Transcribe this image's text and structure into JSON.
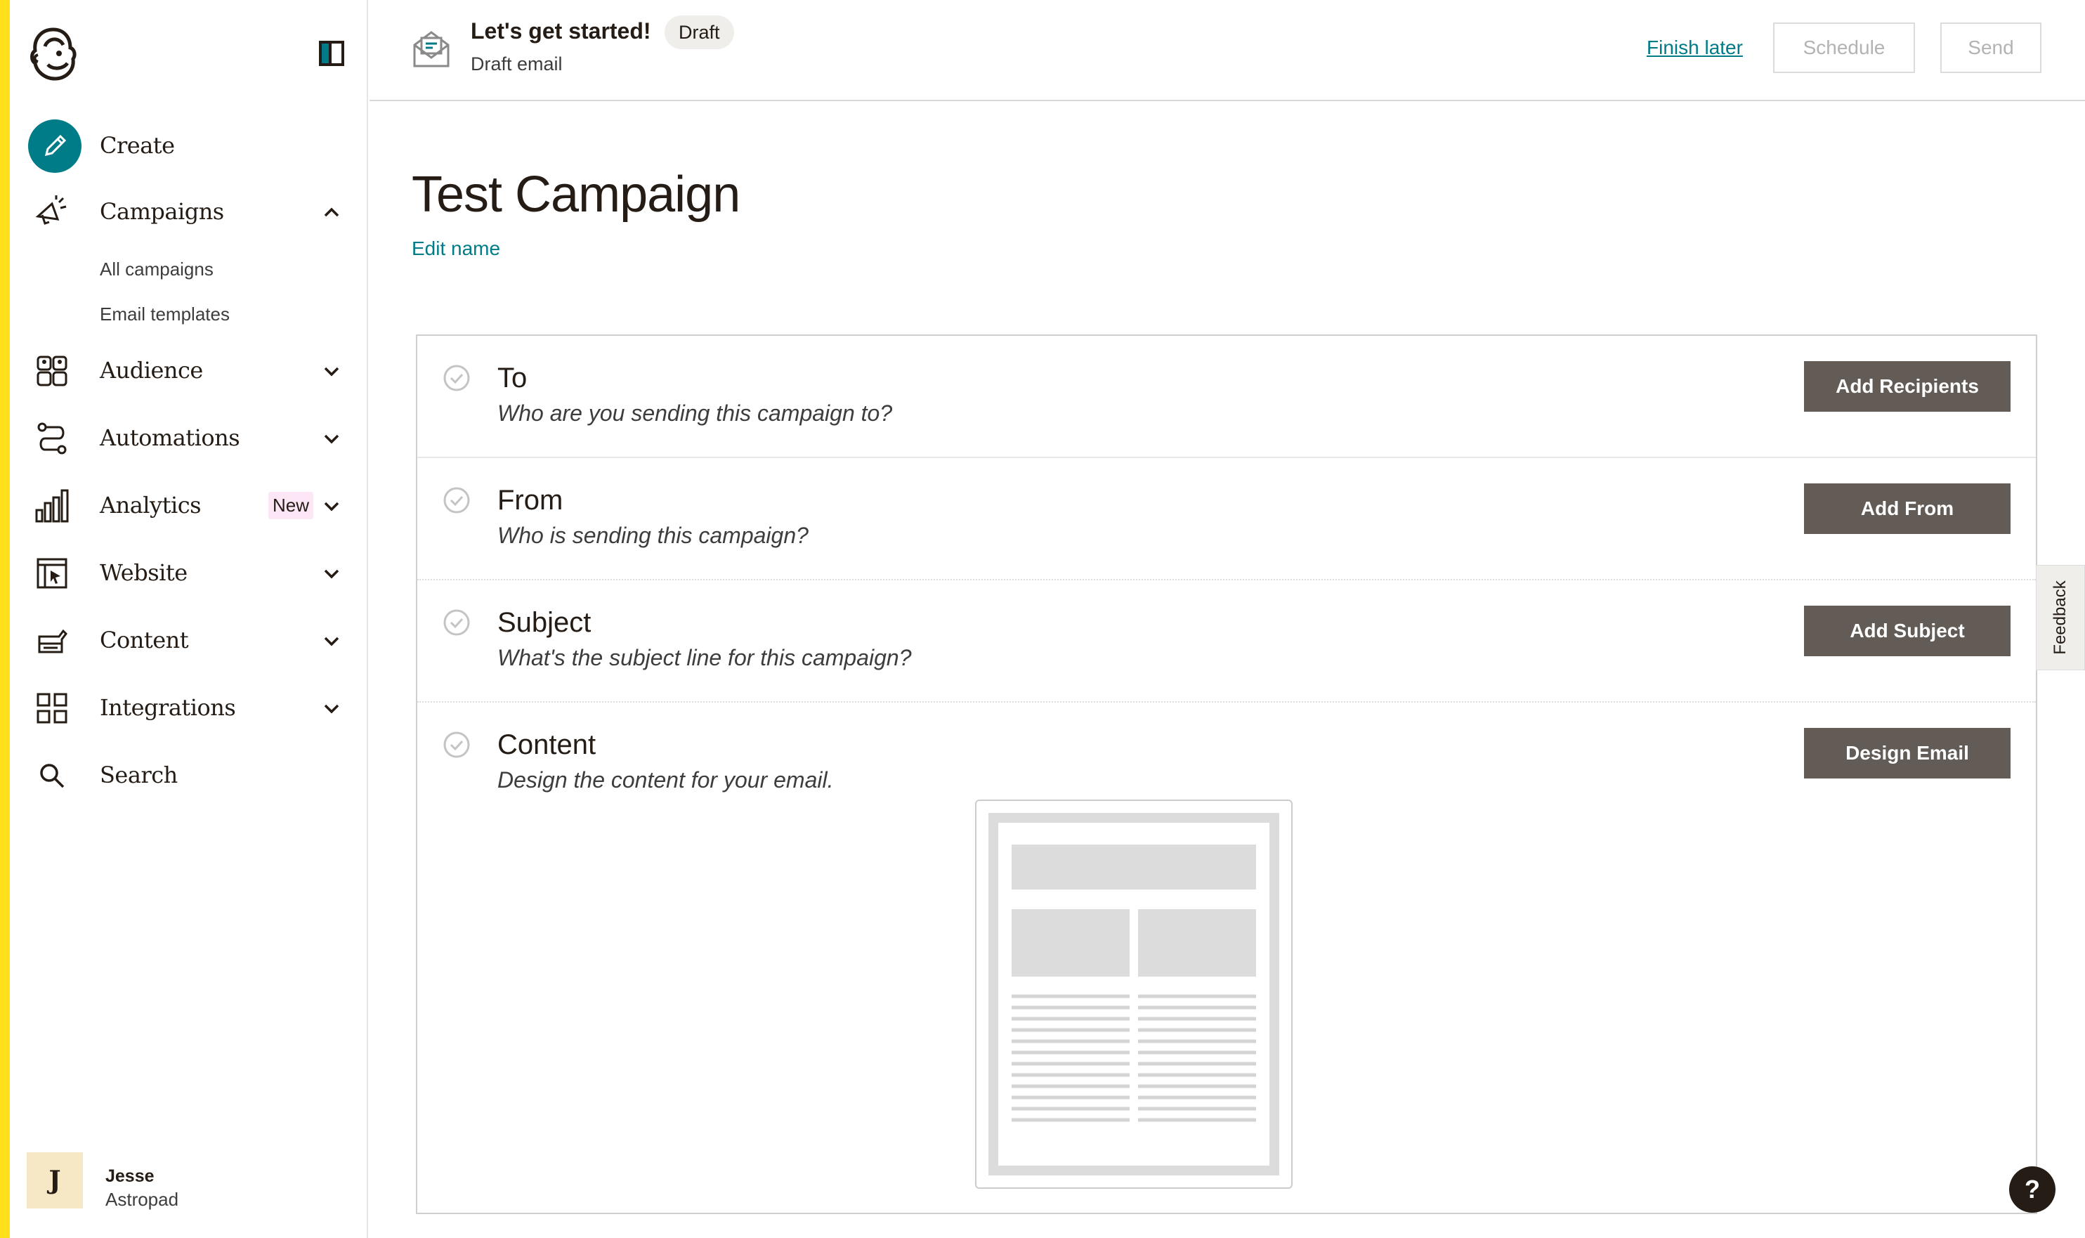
{
  "sidebar": {
    "logo": "freddie-logo",
    "collapse_icon": "sidebar-collapse-icon",
    "create_label": "Create",
    "campaigns_label": "Campaigns",
    "campaigns_sub": [
      "All campaigns",
      "Email templates"
    ],
    "audience_label": "Audience",
    "automations_label": "Automations",
    "analytics_label": "Analytics",
    "analytics_badge": "New",
    "website_label": "Website",
    "content_label": "Content",
    "integrations_label": "Integrations",
    "search_label": "Search",
    "user": {
      "initial": "J",
      "first_name": "Jesse",
      "last_name": "Astropad"
    }
  },
  "header": {
    "title": "Let's get started!",
    "badge": "Draft",
    "subtitle": "Draft email",
    "finish_later": "Finish later",
    "schedule": "Schedule",
    "send": "Send"
  },
  "main": {
    "campaign_name": "Test Campaign",
    "edit_name": "Edit name",
    "checklist": [
      {
        "title": "To",
        "description": "Who are you sending this campaign to?",
        "button": "Add Recipients"
      },
      {
        "title": "From",
        "description": "Who is sending this campaign?",
        "button": "Add From"
      },
      {
        "title": "Subject",
        "description": "What's the subject line for this campaign?",
        "button": "Add Subject"
      },
      {
        "title": "Content",
        "description": "Design the content for your email.",
        "button": "Design Email"
      }
    ]
  },
  "feedback": "Feedback",
  "help": "?",
  "colors": {
    "accent_strip": "#ffe01b",
    "brand_teal": "#007c89",
    "button_dark": "#625b56",
    "text": "#241c15"
  }
}
